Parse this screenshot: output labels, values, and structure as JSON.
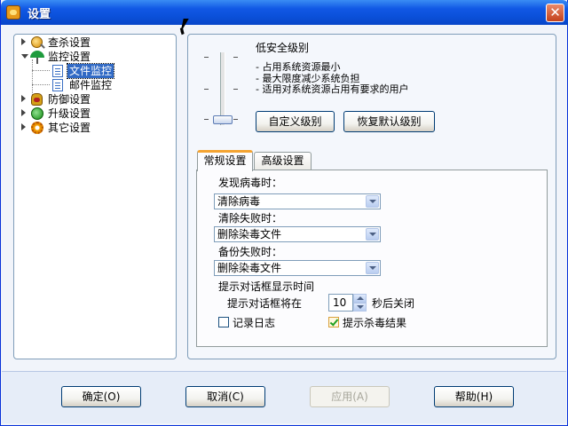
{
  "window": {
    "title": "设置",
    "close_symbol": "✕"
  },
  "tree": {
    "items": [
      {
        "label": "查杀设置",
        "icon": "scan-icon",
        "expanded": false
      },
      {
        "label": "监控设置",
        "icon": "umbrella-icon",
        "expanded": true,
        "children": [
          {
            "label": "文件监控",
            "icon": "document-icon",
            "selected": true
          },
          {
            "label": "邮件监控",
            "icon": "document-icon",
            "selected": false
          }
        ]
      },
      {
        "label": "防御设置",
        "icon": "glove-icon",
        "expanded": false
      },
      {
        "label": "升级设置",
        "icon": "update-icon",
        "expanded": false
      },
      {
        "label": "其它设置",
        "icon": "gear-icon",
        "expanded": false
      }
    ]
  },
  "level": {
    "title": "低安全级别",
    "lines": [
      "- 占用系统资源最小",
      "- 最大限度减少系统负担",
      "- 适用对系统资源占用有要求的用户"
    ],
    "custom_button": "自定义级别",
    "restore_button": "恢复默认级别"
  },
  "tabs": [
    {
      "label": "常规设置",
      "active": true
    },
    {
      "label": "高级设置",
      "active": false
    }
  ],
  "general": {
    "virus_found_label": "发现病毒时：",
    "virus_found_value": "清除病毒",
    "clean_failed_label": "清除失败时：",
    "clean_failed_value": "删除染毒文件",
    "backup_failed_label": "备份失败时：",
    "backup_failed_value": "删除染毒文件",
    "dialog_time_label": "提示对话框显示时间",
    "dialog_prefix": "提示对话框将在",
    "dialog_seconds": "10",
    "dialog_suffix": "秒后关闭",
    "log_label": "记录日志",
    "log_checked": false,
    "show_result_label": "提示杀毒结果",
    "show_result_checked": true
  },
  "footer": {
    "ok": "确定(O)",
    "cancel": "取消(C)",
    "apply": "应用(A)",
    "help": "帮助(H)"
  },
  "colors": {
    "titlebar": "#0a4fd8",
    "selection": "#316ac5",
    "tab_accent": "#f5a431"
  }
}
